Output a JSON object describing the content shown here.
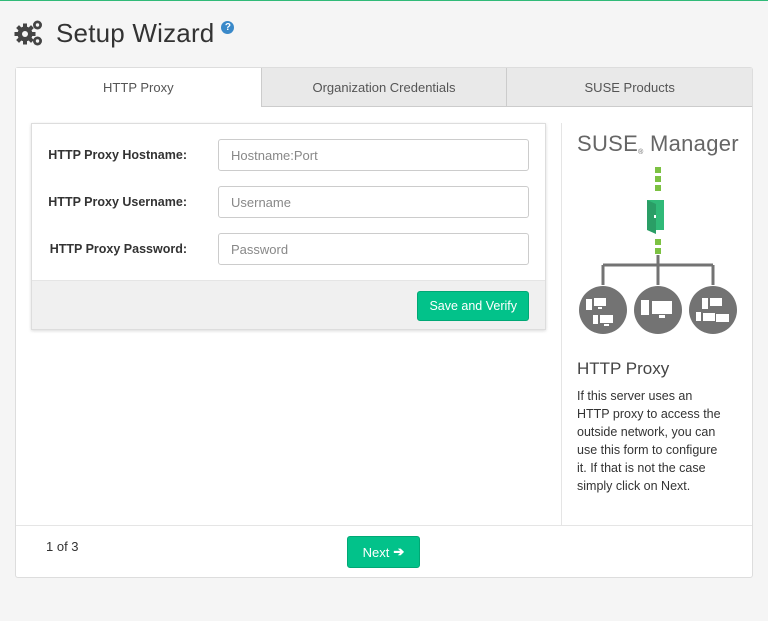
{
  "header": {
    "title": "Setup Wizard",
    "help_icon": "question-circle-icon",
    "icon": "gears-icon"
  },
  "tabs": [
    {
      "label": "HTTP Proxy",
      "active": true
    },
    {
      "label": "Organization Credentials",
      "active": false
    },
    {
      "label": "SUSE Products",
      "active": false
    }
  ],
  "form": {
    "hostname": {
      "label": "HTTP Proxy Hostname:",
      "value": "",
      "placeholder": "Hostname:Port"
    },
    "username": {
      "label": "HTTP Proxy Username:",
      "value": "",
      "placeholder": "Username"
    },
    "password": {
      "label": "HTTP Proxy Password:",
      "value": "",
      "placeholder": "Password"
    },
    "save_label": "Save and Verify"
  },
  "side": {
    "brand": "SUSE",
    "brand_reg": "®",
    "brand_suffix": " Manager",
    "title": "HTTP Proxy",
    "description": "If this server uses an HTTP proxy to access the outside network, you can use this form to configure it. If that is not the case simply click on Next."
  },
  "footer": {
    "page_count": "1 of 3",
    "next_label": "Next"
  },
  "colors": {
    "accent": "#02c28a",
    "brand_green": "#30ba78",
    "help_blue": "#3a89c9",
    "diagram_gray": "#737373"
  }
}
